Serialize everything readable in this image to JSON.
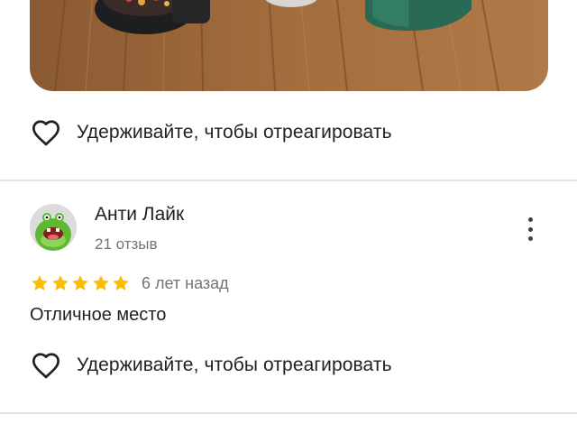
{
  "previous_review": {
    "react_label": "Удерживайте, чтобы отреагировать",
    "heart_icon": "heart-outline-icon"
  },
  "review": {
    "author": "Анти Лайк",
    "review_count": "21 отзыв",
    "rating": 5,
    "rating_max": 5,
    "star_color": "#fbbc04",
    "date": "6 лет назад",
    "text": "Отличное место",
    "react_label": "Удерживайте, чтобы отреагировать",
    "heart_icon": "heart-outline-icon",
    "menu_icon": "more-vertical-icon",
    "avatar_icon": "green-monster-avatar"
  },
  "colors": {
    "text_primary": "#202124",
    "text_secondary": "#70757a",
    "divider": "#e3e3e3"
  }
}
